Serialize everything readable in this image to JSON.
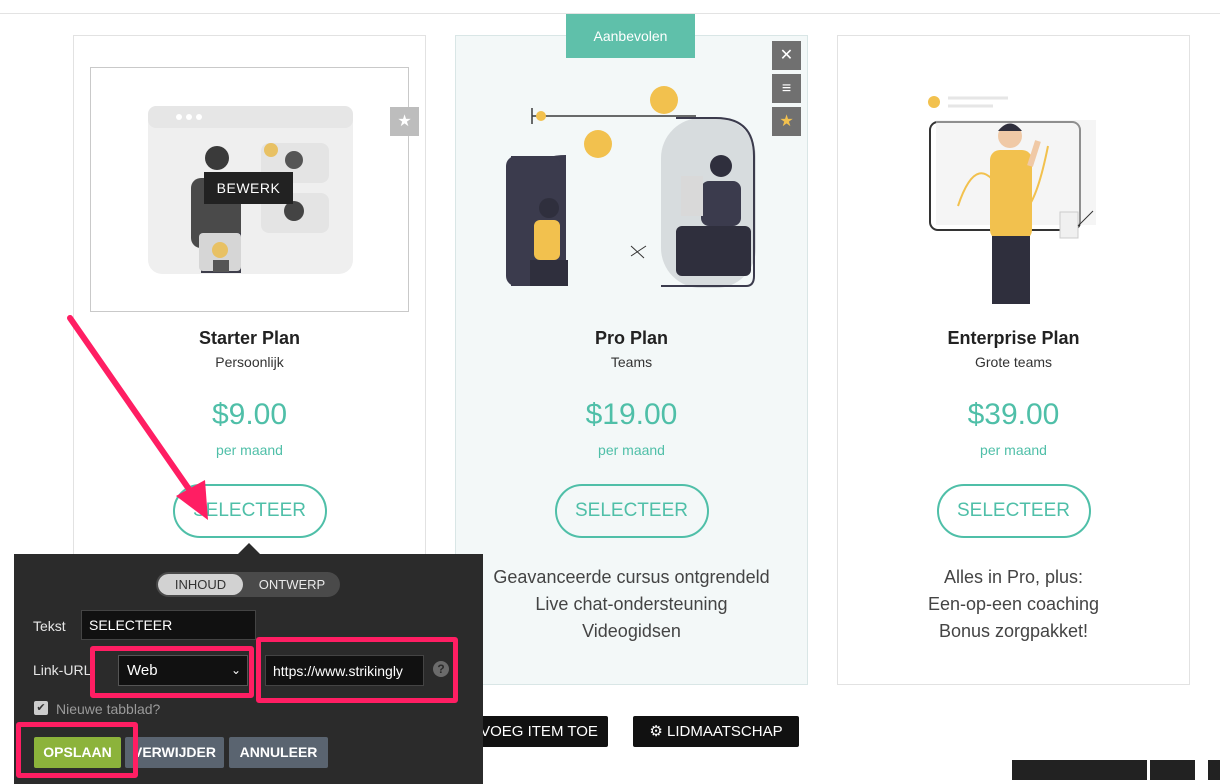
{
  "plans": [
    {
      "title": "Starter Plan",
      "subtitle": "Persoonlijk",
      "price": "$9.00",
      "period": "per maand",
      "button": "SELECTEER",
      "features": []
    },
    {
      "title": "Pro Plan",
      "subtitle": "Teams",
      "price": "$19.00",
      "period": "per maand",
      "button": "SELECTEER",
      "features": [
        "Geavanceerde cursus ontgrendeld",
        "Live chat-ondersteuning",
        "Videogidsen"
      ]
    },
    {
      "title": "Enterprise Plan",
      "subtitle": "Grote teams",
      "price": "$39.00",
      "period": "per maand",
      "button": "SELECTEER",
      "features": [
        "Alles in Pro, plus:",
        "Een-op-een coaching",
        "Bonus zorgpakket!"
      ]
    }
  ],
  "badge": "Aanbevolen",
  "edit_overlay": "BEWERK",
  "editor": {
    "tab_content": "INHOUD",
    "tab_design": "ONTWERP",
    "text_label": "Tekst",
    "text_value": "SELECTEER",
    "link_label": "Link-URL",
    "link_type": "Web",
    "url_value": "https://www.strikingly",
    "help": "?",
    "new_tab_label": "Nieuwe tabblad?",
    "save": "OPSLAAN",
    "delete": "VERWIJDER",
    "cancel": "ANNULEER"
  },
  "add_item": "VOEG ITEM TOE",
  "membership": "LIDMAATSCHAP",
  "colors": {
    "accent": "#4fbfa8",
    "badge": "#5fc0aa",
    "highlight": "#ff1e63",
    "save_button": "#8cb33b"
  }
}
